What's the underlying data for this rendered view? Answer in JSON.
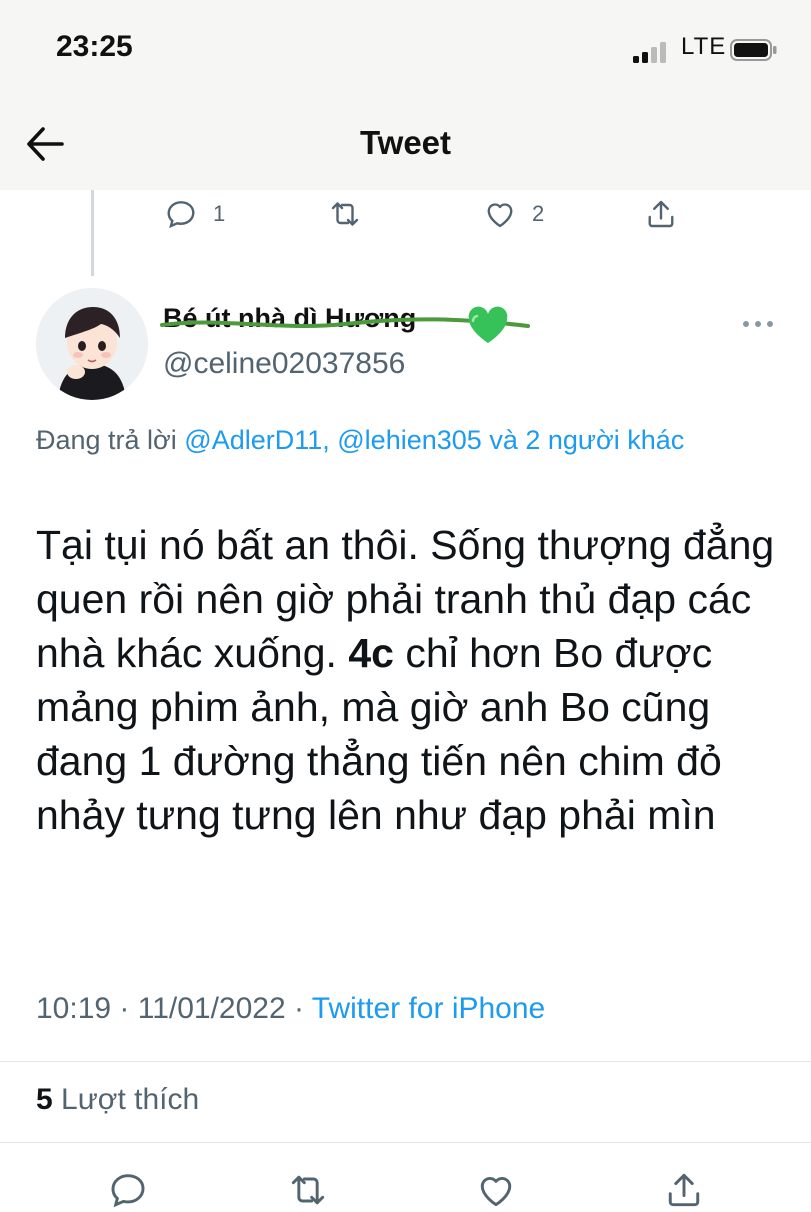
{
  "status_bar": {
    "time": "23:25",
    "network": "LTE"
  },
  "nav": {
    "title": "Tweet"
  },
  "previous_tweet_actions": {
    "reply_count": "1",
    "retweet_count": "",
    "like_count": "2"
  },
  "author": {
    "display_name": "Bé út nhà dì Hương",
    "emoji": "💚",
    "handle": "@celine02037856"
  },
  "reply_info": {
    "prefix": "Đang trả lời",
    "mention1": "@AdlerD11,",
    "mention2": "@lehien305",
    "connector": "và",
    "others": "2 người khác"
  },
  "tweet": {
    "text_part1": "Tại tụi nó bất an thôi. Sống thượng đẳng quen rồi nên giờ phải tranh thủ đạp các nhà khác xuống.",
    "bold": "4c",
    "text_part2": "chỉ hơn Bo được mảng phim ảnh, mà giờ anh Bo cũng đang 1 đường thẳng tiến nên chim đỏ nhảy tưng tưng lên như đạp phải mìn"
  },
  "meta": {
    "time": "10:19",
    "date": "11/01/2022",
    "source": "Twitter for iPhone"
  },
  "likes": {
    "count": "5",
    "label": "Lượt thích"
  },
  "colors": {
    "link": "#1d9bf0",
    "secondary": "#536471",
    "text": "#0f1419"
  }
}
